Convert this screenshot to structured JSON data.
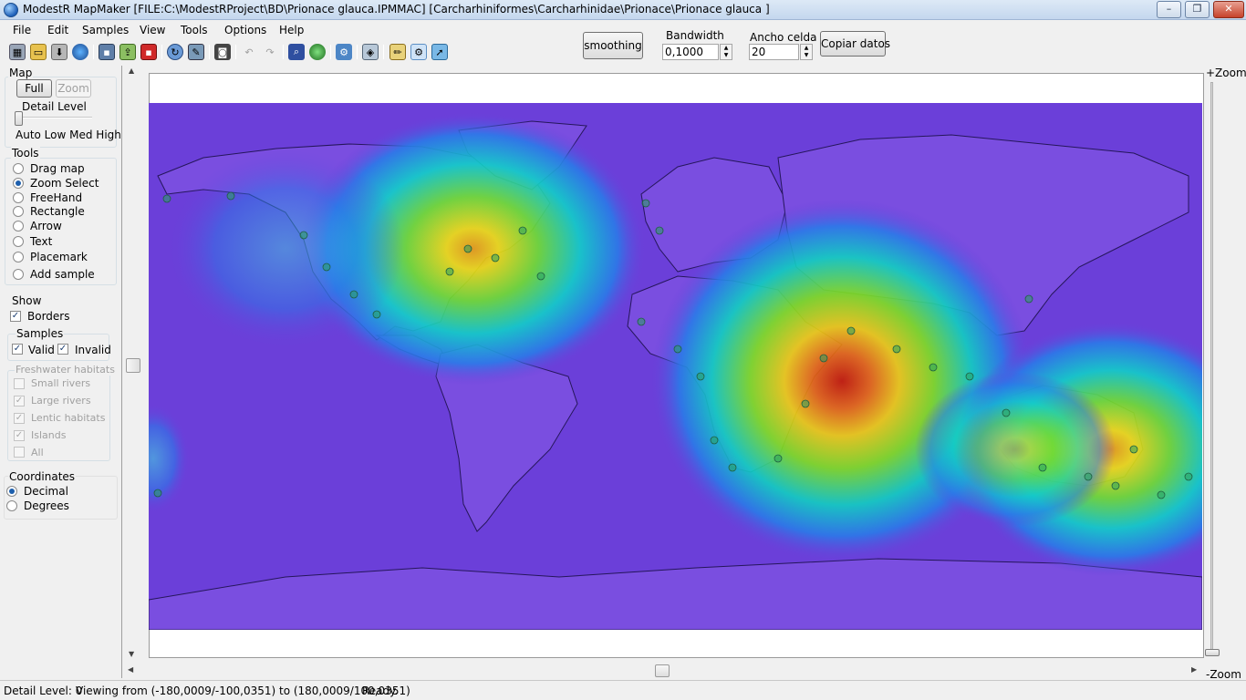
{
  "window": {
    "title": "ModestR MapMaker [FILE:C:\\ModestRProject\\BD\\Prionace glauca.IPMMAC] [Carcharhiniformes\\Carcharhinidae\\Prionace\\Prionace glauca ]",
    "controls": {
      "minimize": "–",
      "maximize": "❐",
      "close": "✕"
    }
  },
  "menu": [
    "File",
    "Edit",
    "Samples",
    "View",
    "Tools",
    "Options",
    "Help"
  ],
  "toolbar": {
    "icons": [
      "grid-icon",
      "open-folder-icon",
      "load-icon",
      "globe-search-icon",
      "save-icon",
      "export-icon",
      "save-red-icon",
      "refresh-icon",
      "edit-icon",
      "camera-icon",
      "undo-icon",
      "redo-icon",
      "search-map-icon",
      "globe-icon",
      "settings-icon",
      "layers-icon",
      "edit-pencil-icon",
      "filter-icon",
      "run-icon"
    ]
  },
  "kde": {
    "smoothing_label": "smoothing",
    "bandwidth_label": "Bandwidth",
    "bandwidth_value": "0,1000",
    "cell_label": "Ancho celda",
    "cell_value": "20",
    "copy_label": "Copiar datos"
  },
  "left": {
    "map_group": "Map",
    "full_btn": "Full",
    "zoom_btn": "Zoom",
    "detail_label": "Detail Level",
    "detail_levels": "Auto Low Med High",
    "tools_group": "Tools",
    "tools": [
      {
        "label": "Drag map",
        "selected": false
      },
      {
        "label": "Zoom Select",
        "selected": true
      },
      {
        "label": "FreeHand",
        "selected": false
      },
      {
        "label": "Rectangle",
        "selected": false
      },
      {
        "label": "Arrow",
        "selected": false
      },
      {
        "label": "Text",
        "selected": false
      },
      {
        "label": "Placemark",
        "selected": false
      },
      {
        "label": "Add sample",
        "selected": false
      }
    ],
    "show_group": "Show",
    "borders_label": "Borders",
    "samples_group": "Samples",
    "valid_label": "Valid",
    "invalid_label": "Invalid",
    "fresh_group": "Freshwater habitats",
    "fresh": [
      {
        "label": "Small rivers",
        "checked": false
      },
      {
        "label": "Large rivers",
        "checked": true
      },
      {
        "label": "Lentic habitats",
        "checked": true
      },
      {
        "label": "Islands",
        "checked": true
      },
      {
        "label": "All",
        "checked": false
      }
    ],
    "coords_group": "Coordinates",
    "decimal_label": "Decimal",
    "degrees_label": "Degrees"
  },
  "zoom": {
    "plus": "+Zoom",
    "minus": "-Zoom"
  },
  "status": {
    "detail": "Detail Level: 0",
    "viewing": "Viewing from (-180,0009/-100,0351) to (180,0009/100,0351)",
    "state": "Ready."
  },
  "colors": {
    "ocean": "#6b3fd9",
    "land": "#7a4ee0",
    "hot": "#c81e00",
    "accent": "#1d5fad"
  }
}
